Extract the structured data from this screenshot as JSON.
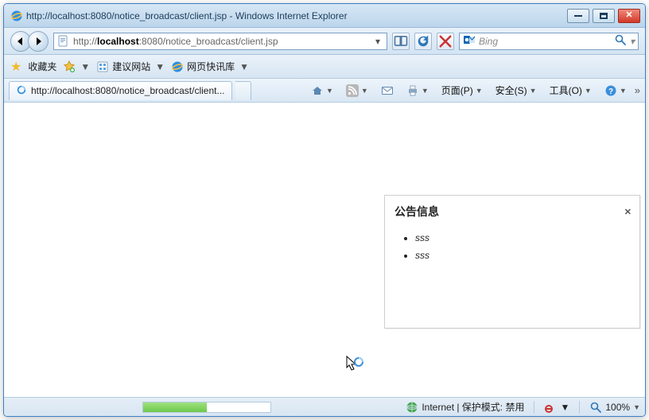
{
  "window": {
    "title_url": "http://localhost:8080/notice_broadcast/client.jsp",
    "title_app": "Windows Internet Explorer"
  },
  "addressbar": {
    "url_prefix": "http://",
    "url_bold": "localhost",
    "url_suffix": ":8080/notice_broadcast/client.jsp"
  },
  "search": {
    "placeholder": "Bing"
  },
  "favorites": {
    "label": "收藏夹",
    "item1": "建议网站",
    "item2": "网页快讯库"
  },
  "tabs": {
    "active": "http://localhost:8080/notice_broadcast/client..."
  },
  "commandbar": {
    "page": "页面(P)",
    "safety": "安全(S)",
    "tools": "工具(O)"
  },
  "notice": {
    "title": "公告信息",
    "items": [
      "sss",
      "sss"
    ]
  },
  "statusbar": {
    "zone": "Internet | 保护模式: 禁用",
    "zoom": "100%"
  }
}
